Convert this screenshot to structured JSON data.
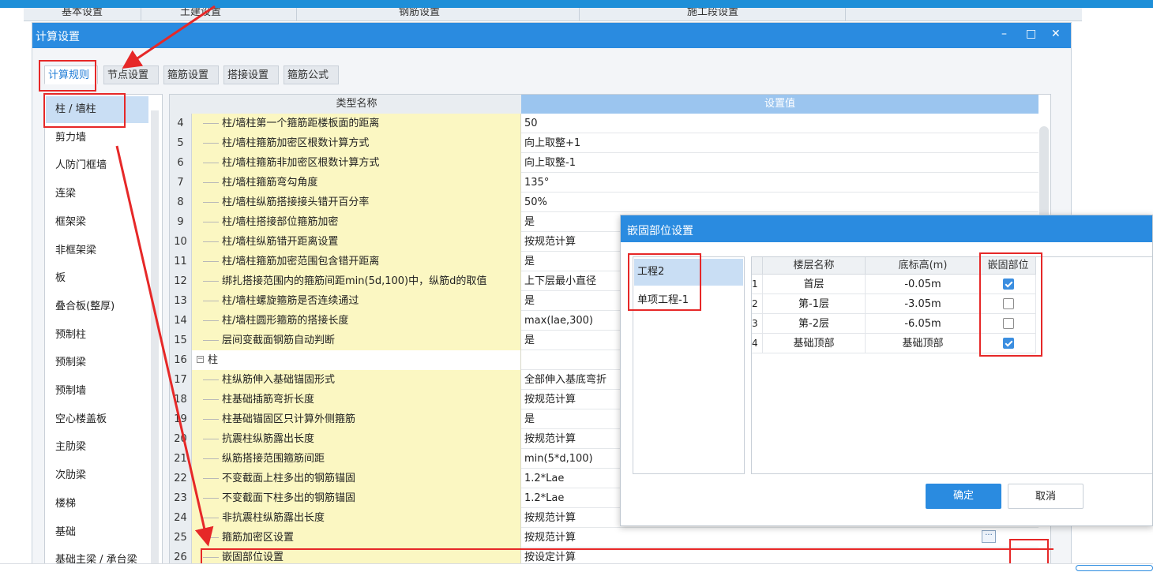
{
  "background_tabs": [
    "基本设置",
    "土建设置",
    "钢筋设置",
    "施工段设置"
  ],
  "window": {
    "title": "计算设置",
    "controls": {
      "minimize": "–",
      "maximize": "□",
      "close": "✕"
    }
  },
  "tabs": [
    "计算规则",
    "节点设置",
    "箍筋设置",
    "搭接设置",
    "箍筋公式"
  ],
  "active_tab": 0,
  "sidebar": {
    "items": [
      "柱 / 墙柱",
      "剪力墙",
      "人防门框墙",
      "连梁",
      "框架梁",
      "非框架梁",
      "板",
      "叠合板(整厚)",
      "预制柱",
      "预制梁",
      "预制墙",
      "空心楼盖板",
      "主肋梁",
      "次肋梁",
      "楼梯",
      "基础",
      "基础主梁 / 承台梁"
    ],
    "active": 0
  },
  "grid": {
    "col_name": "类型名称",
    "col_value": "设置值",
    "rows": [
      {
        "num": "4",
        "name": "柱/墙柱第一个箍筋距楼板面的距离",
        "value": "50"
      },
      {
        "num": "5",
        "name": "柱/墙柱箍筋加密区根数计算方式",
        "value": "向上取整+1"
      },
      {
        "num": "6",
        "name": "柱/墙柱箍筋非加密区根数计算方式",
        "value": "向上取整-1"
      },
      {
        "num": "7",
        "name": "柱/墙柱箍筋弯勾角度",
        "value": "135°"
      },
      {
        "num": "8",
        "name": "柱/墙柱纵筋搭接接头错开百分率",
        "value": "50%"
      },
      {
        "num": "9",
        "name": "柱/墙柱搭接部位箍筋加密",
        "value": "是"
      },
      {
        "num": "10",
        "name": "柱/墙柱纵筋错开距离设置",
        "value": "按规范计算"
      },
      {
        "num": "11",
        "name": "柱/墙柱箍筋加密范围包含错开距离",
        "value": "是"
      },
      {
        "num": "12",
        "name": "绑扎搭接范围内的箍筋间距min(5d,100)中，纵筋d的取值",
        "value": "上下层最小直径"
      },
      {
        "num": "13",
        "name": "柱/墙柱螺旋箍筋是否连续通过",
        "value": "是"
      },
      {
        "num": "14",
        "name": "柱/墙柱圆形箍筋的搭接长度",
        "value": "max(lae,300)"
      },
      {
        "num": "15",
        "name": "层间变截面钢筋自动判断",
        "value": "是"
      },
      {
        "num": "16",
        "name": "柱",
        "value": "",
        "group": true
      },
      {
        "num": "17",
        "name": "柱纵筋伸入基础锚固形式",
        "value": "全部伸入基底弯折"
      },
      {
        "num": "18",
        "name": "柱基础插筋弯折长度",
        "value": "按规范计算"
      },
      {
        "num": "19",
        "name": "柱基础锚固区只计算外侧箍筋",
        "value": "是"
      },
      {
        "num": "20",
        "name": "抗震柱纵筋露出长度",
        "value": "按规范计算"
      },
      {
        "num": "21",
        "name": "纵筋搭接范围箍筋间距",
        "value": "min(5*d,100)"
      },
      {
        "num": "22",
        "name": "不变截面上柱多出的钢筋锚固",
        "value": "1.2*Lae"
      },
      {
        "num": "23",
        "name": "不变截面下柱多出的钢筋锚固",
        "value": "1.2*Lae"
      },
      {
        "num": "24",
        "name": "非抗震柱纵筋露出长度",
        "value": "按规范计算"
      },
      {
        "num": "25",
        "name": "箍筋加密区设置",
        "value": "按规范计算"
      },
      {
        "num": "26",
        "name": "嵌固部位设置",
        "value": "按设定计算"
      }
    ],
    "ellipsis_label": "···"
  },
  "dialog": {
    "title": "嵌固部位设置",
    "projects": [
      "工程2",
      "单项工程-1"
    ],
    "active_project": 0,
    "col_floor": "楼层名称",
    "col_elev": "底标高(m)",
    "col_embed": "嵌固部位",
    "rows": [
      {
        "num": "1",
        "floor": "首层",
        "elev": "-0.05m",
        "checked": true
      },
      {
        "num": "2",
        "floor": "第-1层",
        "elev": "-3.05m",
        "checked": false
      },
      {
        "num": "3",
        "floor": "第-2层",
        "elev": "-6.05m",
        "checked": false
      },
      {
        "num": "4",
        "floor": "基础顶部",
        "elev": "基础顶部",
        "checked": true
      }
    ],
    "ok_label": "确定",
    "cancel_label": "取消"
  },
  "colors": {
    "accent": "#2a8be0",
    "highlight": "#e62828",
    "name_cell": "#fbf7c2",
    "header_value": "#9bc5ef"
  }
}
